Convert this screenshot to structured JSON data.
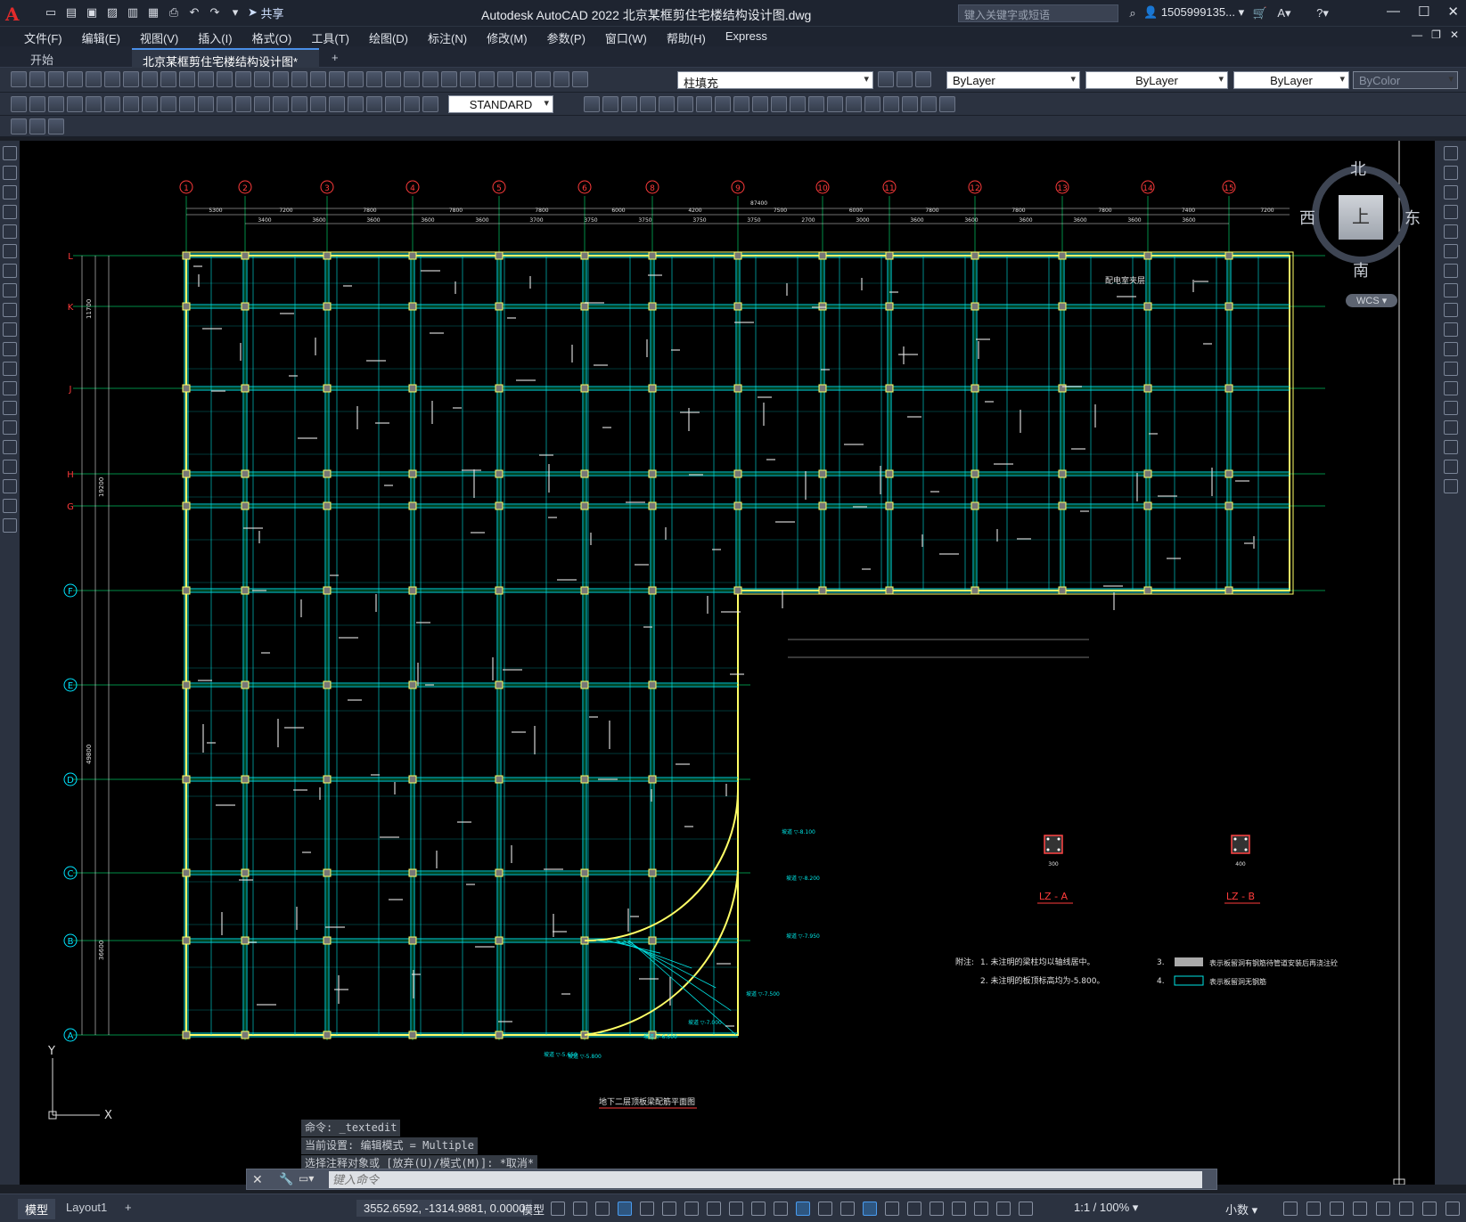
{
  "app": {
    "logo": "A",
    "title": "Autodesk AutoCAD 2022    北京某框剪住宅楼结构设计图.dwg",
    "search_placeholder": "键入关键字或短语",
    "user": "1505999135...",
    "share": "共享"
  },
  "menu": [
    "文件(F)",
    "编辑(E)",
    "视图(V)",
    "插入(I)",
    "格式(O)",
    "工具(T)",
    "绘图(D)",
    "标注(N)",
    "修改(M)",
    "参数(P)",
    "窗口(W)",
    "帮助(H)",
    "Express"
  ],
  "tabs": {
    "start": "开始",
    "doc": "北京某框剪住宅楼结构设计图*",
    "add": "+"
  },
  "toolbar": {
    "layer_combo": "柱填充",
    "color_combo": "ByLayer",
    "linetype_combo": "ByLayer",
    "lineweight_combo": "ByLayer",
    "plotstyle_combo": "ByColor",
    "textstyle_combo": "STANDARD"
  },
  "viewcube": {
    "north": "北",
    "south": "南",
    "east": "东",
    "west": "西",
    "top": "上",
    "wcs": "WCS"
  },
  "drawing": {
    "grid_cols": [
      "1",
      "2",
      "3",
      "4",
      "5",
      "6",
      "8",
      "9",
      "10",
      "11",
      "12",
      "13",
      "14",
      "15"
    ],
    "grid_rows": [
      "L",
      "K",
      "J",
      "H",
      "G",
      "F",
      "E",
      "D",
      "C",
      "B",
      "A"
    ],
    "overall_dim": "87400",
    "top_dims": [
      "5300",
      "7200",
      "7800",
      "7800",
      "7800",
      "6000",
      "4200",
      "7500",
      "6000",
      "7800",
      "7800",
      "7800",
      "7400",
      "7200"
    ],
    "sub_dims": [
      "3400",
      "3600",
      "3600",
      "3600",
      "3600",
      "3700",
      "3750",
      "3750",
      "3750",
      "3750",
      "2700",
      "3000",
      "3600",
      "3600",
      "3600",
      "3600",
      "3600",
      "3600"
    ],
    "left_dims": [
      "11700",
      "19200",
      "49800",
      "36600"
    ],
    "room_label": "配电室夹层",
    "note_title": "附注:",
    "notes": [
      "1. 未注明的梁柱均以轴线居中。",
      "2. 未注明的板顶标高均为-5.800。",
      "3.",
      "4."
    ],
    "notes_right": [
      "表示板留洞有钢筋待管道安装后再浇注砼",
      "表示板留洞无钢筋"
    ],
    "column_details": [
      {
        "name": "LZ - A",
        "w": "300"
      },
      {
        "name": "LZ - B",
        "w": "400"
      }
    ],
    "elevations": [
      "坡道 ▽-5.800",
      "坡道 ▽-6.500",
      "坡道 ▽-7.000",
      "坡道 ▽-7.500",
      "坡道 ▽-7.950",
      "坡道 ▽-8.200",
      "坡道 ▽-8.100",
      "坡道 ▽-5.650"
    ],
    "drawing_title": "地下二层顶板梁配筋平面图",
    "ucs_x": "X",
    "ucs_y": "Y"
  },
  "command": {
    "history": [
      "命令: _textedit",
      "当前设置: 编辑模式 = Multiple",
      "选择注释对象或 [放弃(U)/模式(M)]: *取消*"
    ],
    "placeholder": "键入命令"
  },
  "status": {
    "model_tab": "模型",
    "layout_tab": "Layout1",
    "add_tab": "+",
    "coords": "3552.6592, -1314.9881, 0.0000",
    "space": "模型",
    "scale": "1:1 / 100%",
    "units": "小数"
  },
  "colors": {
    "grid": "#00ff7f",
    "beam": "#00e5e5",
    "column": "#ffff66",
    "bubble": "#ff3b3b",
    "dim": "#e0e0e0"
  }
}
